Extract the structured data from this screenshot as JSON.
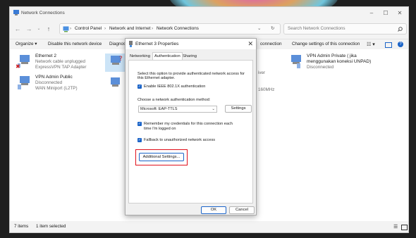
{
  "window": {
    "title": "Network Connections",
    "address": {
      "breadcrumb": [
        "Control Panel",
        "Network and Internet",
        "Network Connections"
      ],
      "separator": "›"
    },
    "search_placeholder": "Search Network Connections",
    "toolbar": {
      "organize": "Organize ▾",
      "disable": "Disable this network device",
      "diagnose": "Diagnos",
      "rename_partial": "connection",
      "change_settings": "Change settings of this connection"
    },
    "connections": [
      {
        "name": "Ethernet 2",
        "line1": "Network cable unplugged",
        "line2": "ExpressVPN TAP Adapter"
      },
      {
        "name": "VPN Admin Public",
        "line1": "Disconnected",
        "line2": "WAN Miniport (L2TP)"
      },
      {
        "name": "VPN Admin Private ( jika",
        "line1": "menggunakan koneksi UNPAD)",
        "line2": "Disconnected"
      }
    ],
    "partial_texts": {
      "driver": "iver",
      "mhz": "160MHz"
    },
    "status": {
      "items": "7 items",
      "selected": "1 item selected"
    }
  },
  "dialog": {
    "title": "Ethernet 3 Properties",
    "tabs": [
      "Networking",
      "Authentication",
      "Sharing"
    ],
    "active_tab": "Authentication",
    "intro": [
      "Select this option to provide authenticated network access for",
      "this Ethernet adapter."
    ],
    "enable_8021x": "Enable IEEE 802.1X authentication",
    "choose_method": "Choose a network authentication method:",
    "method_value": "Microsoft: EAP-TTLS",
    "settings_button": "Settings",
    "remember_creds": [
      "Remember my credentials for this connection each",
      "time I'm logged on"
    ],
    "fallback": "Fallback to unauthorized network access",
    "additional_settings": "Additional Settings...",
    "ok": "OK",
    "cancel": "Cancel"
  },
  "colors": {
    "accent": "#1b64c8",
    "highlight_box": "#e0101b"
  }
}
